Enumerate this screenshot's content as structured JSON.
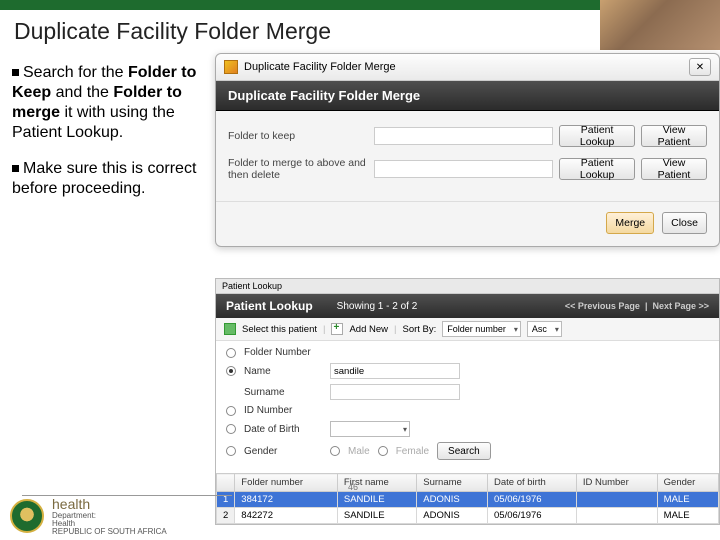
{
  "slide_title": "Duplicate Facility Folder Merge",
  "bullets": {
    "b1a": "Search for the ",
    "b1b": "Folder to Keep",
    "b1c": " and the ",
    "b1d": "Folder to merge",
    "b1e": " it with using the Patient Lookup.",
    "b2": "Make sure this is correct before proceeding."
  },
  "dialog1": {
    "window_title": "Duplicate Facility Folder Merge",
    "close_glyph": "✕",
    "header": "Duplicate Facility Folder Merge",
    "row1_label": "Folder to keep",
    "row2_label": "Folder to merge to above and then delete",
    "btn_lookup": "Patient Lookup",
    "btn_view": "View Patient",
    "btn_merge": "Merge",
    "btn_close": "Close"
  },
  "panel2": {
    "tab": "Patient Lookup",
    "header_title": "Patient Lookup",
    "header_count": "Showing 1 - 2 of 2",
    "pager_prev": "<< Previous Page",
    "pager_next": "Next Page >>",
    "toolbar": {
      "select": "Select this patient",
      "addnew": "Add New",
      "sortby": "Sort By:",
      "sort_field": "Folder number",
      "sort_dir": "Asc"
    },
    "filters": {
      "folder": "Folder Number",
      "name": "Name",
      "surname": "Surname",
      "id": "ID Number",
      "dob": "Date of Birth",
      "gender": "Gender",
      "male": "Male",
      "female": "Female",
      "name_value": "sandile",
      "search": "Search"
    },
    "table": {
      "cols": [
        "",
        "Folder number",
        "First name",
        "Surname",
        "Date of birth",
        "ID Number",
        "Gender"
      ],
      "rows": [
        {
          "n": "1",
          "folder": "384172",
          "first": "SANDILE",
          "sur": "ADONIS",
          "dob": "05/06/1976",
          "id": "",
          "gen": "MALE"
        },
        {
          "n": "2",
          "folder": "842272",
          "first": "SANDILE",
          "sur": "ADONIS",
          "dob": "05/06/1976",
          "id": "",
          "gen": "MALE"
        }
      ]
    }
  },
  "footer": {
    "brand": "health",
    "line1": "Department:",
    "line2": "Health",
    "line3": "REPUBLIC OF SOUTH AFRICA"
  },
  "page_number": "46"
}
